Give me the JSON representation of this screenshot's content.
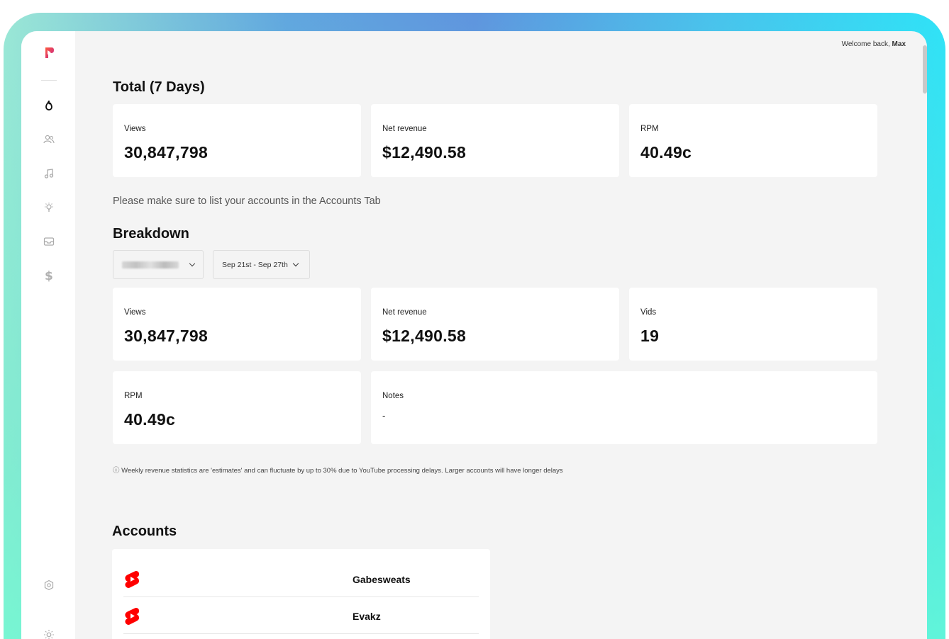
{
  "header": {
    "welcome_prefix": "Welcome back,",
    "user_name": "Max"
  },
  "sidebar": {
    "icons": [
      "app-logo-icon",
      "flame-icon",
      "users-icon",
      "music-note-icon",
      "lightbulb-icon",
      "inbox-icon",
      "dollar-icon",
      "settings-icon",
      "sun-icon"
    ]
  },
  "total": {
    "title": "Total (7 Days)",
    "cards": [
      {
        "label": "Views",
        "value": "30,847,798"
      },
      {
        "label": "Net revenue",
        "value": "$12,490.58"
      },
      {
        "label": "RPM",
        "value": "40.49c"
      }
    ]
  },
  "accounts_notice": "Please make sure to list your accounts in the Accounts Tab",
  "breakdown": {
    "title": "Breakdown",
    "date_range": "Sep 21st - Sep 27th",
    "cards": [
      {
        "label": "Views",
        "value": "30,847,798"
      },
      {
        "label": "Net revenue",
        "value": "$12,490.58"
      },
      {
        "label": "Vids",
        "value": "19"
      },
      {
        "label": "RPM",
        "value": "40.49c"
      },
      {
        "label": "Notes",
        "value": "-"
      }
    ],
    "disclaimer": "ⓘ Weekly revenue statistics are 'estimates' and can fluctuate by up to 30% due to YouTube processing delays. Larger accounts will have longer delays"
  },
  "accounts": {
    "title": "Accounts",
    "items": [
      {
        "name": "Gabesweats",
        "platform": "youtube-shorts-icon"
      },
      {
        "name": "Evakz",
        "platform": "youtube-shorts-icon"
      }
    ]
  },
  "colors": {
    "accent": "#ff0000",
    "background": "#f4f4f4",
    "card": "#ffffff"
  }
}
